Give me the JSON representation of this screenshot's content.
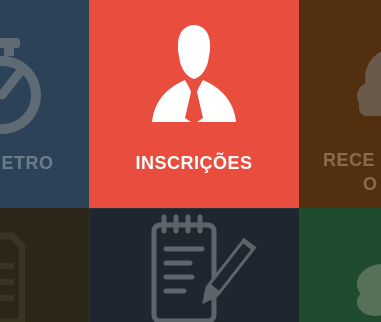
{
  "tiles": [
    {
      "label": "NETRO",
      "icon": "stopwatch-icon",
      "color": "#2b4259"
    },
    {
      "label": "INSCRIÇÕES",
      "icon": "user-icon",
      "color": "#e84d3d"
    },
    {
      "label_line1": "RECE",
      "label_line2": "O",
      "icon": "cloud-icon",
      "color": "#52300f"
    },
    {
      "icon": "list-icon",
      "color": "#2c2618"
    },
    {
      "icon": "notepad-pencil-icon",
      "color": "#1f2630"
    },
    {
      "icon": "chat-icon",
      "color": "#1f4b2e"
    }
  ]
}
